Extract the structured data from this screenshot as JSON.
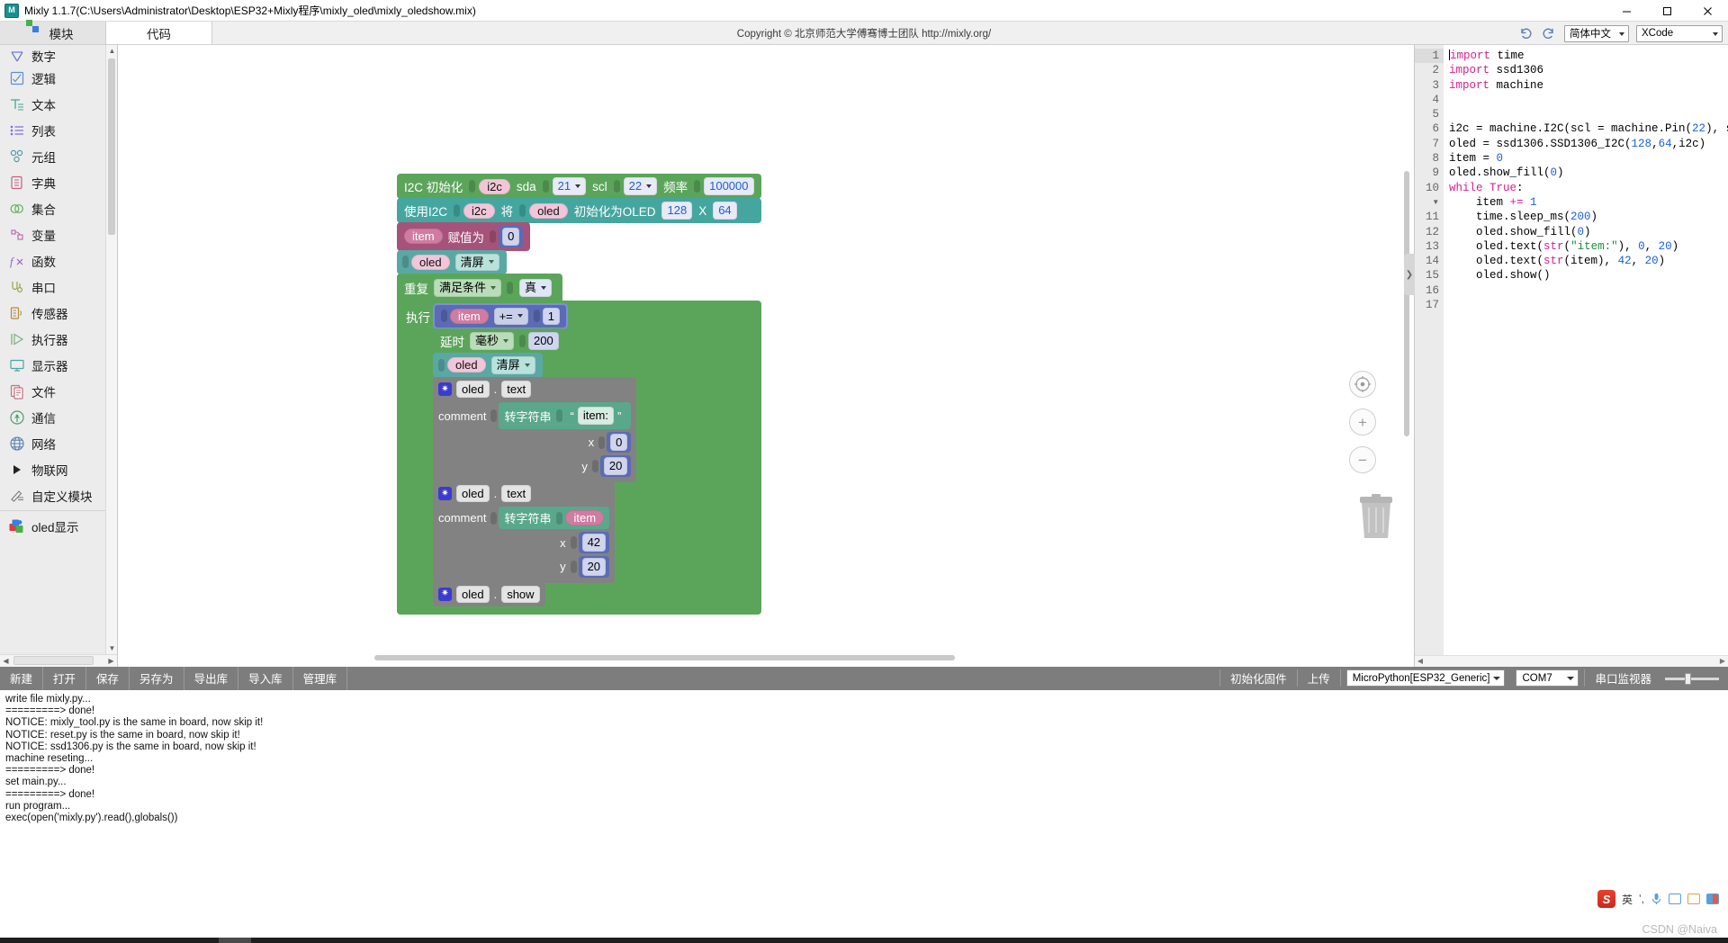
{
  "window": {
    "title": "Mixly 1.1.7(C:\\Users\\Administrator\\Desktop\\ESP32+Mixly程序\\mixly_oled\\mixly_oledshow.mix)",
    "app_icon": "mixly-logo-icon",
    "minimize": "minimize-icon",
    "maximize": "maximize-icon",
    "close": "close-icon"
  },
  "topbar": {
    "tabs": [
      {
        "label": "模块",
        "icon": "puzzle-icon",
        "active": false
      },
      {
        "label": "代码",
        "icon": "",
        "active": true
      }
    ],
    "copyright": "Copyright © 北京师范大学傅骞博士团队 http://mixly.org/",
    "undo_icon": "undo-icon",
    "redo_icon": "redo-icon",
    "language": "简体中文",
    "theme": "XCode"
  },
  "sidebar": {
    "items": [
      {
        "label": "数字",
        "icon": "math-icon",
        "color": "#6b7fd1"
      },
      {
        "label": "逻辑",
        "icon": "logic-icon",
        "color": "#5b8fd6"
      },
      {
        "label": "文本",
        "icon": "text-icon",
        "color": "#4aa58f"
      },
      {
        "label": "列表",
        "icon": "list-icon",
        "color": "#7b6fd1"
      },
      {
        "label": "元组",
        "icon": "tuple-icon",
        "color": "#4f9ba6"
      },
      {
        "label": "字典",
        "icon": "dict-icon",
        "color": "#c4607f"
      },
      {
        "label": "集合",
        "icon": "set-icon",
        "color": "#5fae5f"
      },
      {
        "label": "变量",
        "icon": "variable-icon",
        "color": "#c06fb0"
      },
      {
        "label": "函数",
        "icon": "function-icon",
        "color": "#9b5fc0"
      },
      {
        "label": "串口",
        "icon": "serial-icon",
        "color": "#9aa44a"
      },
      {
        "label": "传感器",
        "icon": "sensor-icon",
        "color": "#b08b3a"
      },
      {
        "label": "执行器",
        "icon": "actuator-icon",
        "color": "#7fae7f"
      },
      {
        "label": "显示器",
        "icon": "display-icon",
        "color": "#4aa5a5"
      },
      {
        "label": "文件",
        "icon": "file-icon",
        "color": "#c4707a"
      },
      {
        "label": "通信",
        "icon": "communication-icon",
        "color": "#4f9e6e"
      },
      {
        "label": "网络",
        "icon": "network-icon",
        "color": "#5b7fae"
      },
      {
        "label": "物联网",
        "icon": "triangle-right-icon",
        "color": "#222222"
      },
      {
        "label": "自定义模块",
        "icon": "custom-module-icon",
        "color": "#7a7a7a"
      }
    ],
    "extras": [
      {
        "label": "oled显示",
        "icon": "oled-blocks-icon"
      }
    ]
  },
  "workspace": {
    "controls": {
      "center": "center-target-icon",
      "zoom_in": "zoom-in-icon",
      "zoom_out": "zoom-out-icon",
      "trash": "trash-icon"
    },
    "blocks": {
      "i2c_init": {
        "label": "I2C 初始化",
        "var": "i2c",
        "sda_label": "sda",
        "sda_value": "21",
        "scl_label": "scl",
        "scl_value": "22",
        "freq_label": "频率",
        "freq_value": "100000"
      },
      "oled_init": {
        "prefix": "使用I2C",
        "bus_var": "i2c",
        "mid": "将",
        "obj_var": "oled",
        "suffix": "初始化为OLED",
        "width": "128",
        "x_label": "X",
        "height": "64"
      },
      "set_item": {
        "var": "item",
        "label": "赋值为",
        "value": "0"
      },
      "oled_clear_top": {
        "obj": "oled",
        "method": "清屏"
      },
      "while_loop": {
        "repeat_label": "重复",
        "cond_label": "满足条件",
        "cond_value": "真",
        "do_label": "执行"
      },
      "item_inc": {
        "var": "item",
        "op": "+=",
        "value": "1"
      },
      "delay": {
        "label": "延时",
        "unit": "毫秒",
        "value": "200"
      },
      "oled_clear_inner": {
        "obj": "oled",
        "method": "清屏"
      },
      "oled_text_1": {
        "obj": "oled",
        "dot": ".",
        "method": "text",
        "comment_label": "comment",
        "to_string": "转字符串",
        "quote_open": "“",
        "string_value": "item:",
        "quote_close": "”",
        "x_label": "x",
        "x_value": "0",
        "y_label": "y",
        "y_value": "20",
        "gear": "gear-icon"
      },
      "oled_text_2": {
        "obj": "oled",
        "dot": ".",
        "method": "text",
        "comment_label": "comment",
        "to_string": "转字符串",
        "var_value": "item",
        "x_label": "x",
        "x_value": "42",
        "y_label": "y",
        "y_value": "20",
        "gear": "gear-icon"
      },
      "oled_show": {
        "obj": "oled",
        "dot": ".",
        "method": "show",
        "gear": "gear-icon"
      }
    }
  },
  "code": {
    "lines": [
      {
        "n": "1",
        "fold": false,
        "segs": [
          {
            "t": "import",
            "c": "kw"
          },
          {
            "t": " time",
            "c": ""
          }
        ]
      },
      {
        "n": "2",
        "fold": false,
        "segs": [
          {
            "t": "import",
            "c": "kw"
          },
          {
            "t": " ssd1306",
            "c": ""
          }
        ]
      },
      {
        "n": "3",
        "fold": false,
        "segs": [
          {
            "t": "import",
            "c": "kw"
          },
          {
            "t": " machine",
            "c": ""
          }
        ]
      },
      {
        "n": "4",
        "fold": false,
        "segs": []
      },
      {
        "n": "5",
        "fold": false,
        "segs": []
      },
      {
        "n": "6",
        "fold": false,
        "segs": [
          {
            "t": "i2c = machine.I2C(scl = machine.Pin(",
            "c": ""
          },
          {
            "t": "22",
            "c": "num"
          },
          {
            "t": "), sda",
            "c": ""
          }
        ]
      },
      {
        "n": "7",
        "fold": false,
        "segs": [
          {
            "t": "oled = ssd1306.SSD1306_I2C(",
            "c": ""
          },
          {
            "t": "128",
            "c": "num"
          },
          {
            "t": ",",
            "c": ""
          },
          {
            "t": "64",
            "c": "num"
          },
          {
            "t": ",i2c)",
            "c": ""
          }
        ]
      },
      {
        "n": "8",
        "fold": false,
        "segs": [
          {
            "t": "item = ",
            "c": ""
          },
          {
            "t": "0",
            "c": "num"
          }
        ]
      },
      {
        "n": "9",
        "fold": false,
        "segs": [
          {
            "t": "oled.show_fill(",
            "c": ""
          },
          {
            "t": "0",
            "c": "num"
          },
          {
            "t": ")",
            "c": ""
          }
        ]
      },
      {
        "n": "10",
        "fold": true,
        "segs": [
          {
            "t": "while",
            "c": "kw"
          },
          {
            "t": " ",
            "c": ""
          },
          {
            "t": "True",
            "c": "kw"
          },
          {
            "t": ":",
            "c": ""
          }
        ]
      },
      {
        "n": "11",
        "fold": false,
        "segs": [
          {
            "t": "    item ",
            "c": ""
          },
          {
            "t": "+=",
            "c": "kw"
          },
          {
            "t": " ",
            "c": ""
          },
          {
            "t": "1",
            "c": "num"
          }
        ]
      },
      {
        "n": "12",
        "fold": false,
        "segs": [
          {
            "t": "    time.sleep_ms(",
            "c": ""
          },
          {
            "t": "200",
            "c": "num"
          },
          {
            "t": ")",
            "c": ""
          }
        ]
      },
      {
        "n": "13",
        "fold": false,
        "segs": [
          {
            "t": "    oled.show_fill(",
            "c": ""
          },
          {
            "t": "0",
            "c": "num"
          },
          {
            "t": ")",
            "c": ""
          }
        ]
      },
      {
        "n": "14",
        "fold": false,
        "segs": [
          {
            "t": "    oled.text(",
            "c": ""
          },
          {
            "t": "str",
            "c": "kw"
          },
          {
            "t": "(",
            "c": ""
          },
          {
            "t": "\"item:\"",
            "c": "str"
          },
          {
            "t": "), ",
            "c": ""
          },
          {
            "t": "0",
            "c": "num"
          },
          {
            "t": ", ",
            "c": ""
          },
          {
            "t": "20",
            "c": "num"
          },
          {
            "t": ")",
            "c": ""
          }
        ]
      },
      {
        "n": "15",
        "fold": false,
        "segs": [
          {
            "t": "    oled.text(",
            "c": ""
          },
          {
            "t": "str",
            "c": "kw"
          },
          {
            "t": "(item), ",
            "c": ""
          },
          {
            "t": "42",
            "c": "num"
          },
          {
            "t": ", ",
            "c": ""
          },
          {
            "t": "20",
            "c": "num"
          },
          {
            "t": ")",
            "c": ""
          }
        ]
      },
      {
        "n": "16",
        "fold": false,
        "segs": [
          {
            "t": "    oled.show()",
            "c": ""
          }
        ]
      },
      {
        "n": "17",
        "fold": false,
        "segs": []
      }
    ]
  },
  "bottom_toolbar": {
    "buttons": [
      "新建",
      "打开",
      "保存",
      "另存为",
      "导出库",
      "导入库",
      "管理库"
    ],
    "firmware_button": "初始化固件",
    "upload_button": "上传",
    "board": "MicroPython[ESP32_Generic]",
    "port": "COM7",
    "serial_monitor": "串口监视器"
  },
  "console": {
    "lines": [
      "write file mixly.py...",
      "=========> done!",
      "NOTICE: mixly_tool.py is the same in board, now skip it!",
      "NOTICE: reset.py is the same in board, now skip it!",
      "NOTICE: ssd1306.py is the same in board, now skip it!",
      "machine reseting...",
      "=========> done!",
      "set main.py...",
      "=========> done!",
      "run program...",
      "exec(open('mixly.py').read(),globals())"
    ]
  },
  "ime": {
    "logo": "sogou-ime-icon",
    "mode": "英",
    "items": [
      "punctuation-icon",
      "microphone-icon",
      "keyboard-icon",
      "toolbox-icon",
      "menu-icon"
    ]
  },
  "watermark": "CSDN @Naiva"
}
